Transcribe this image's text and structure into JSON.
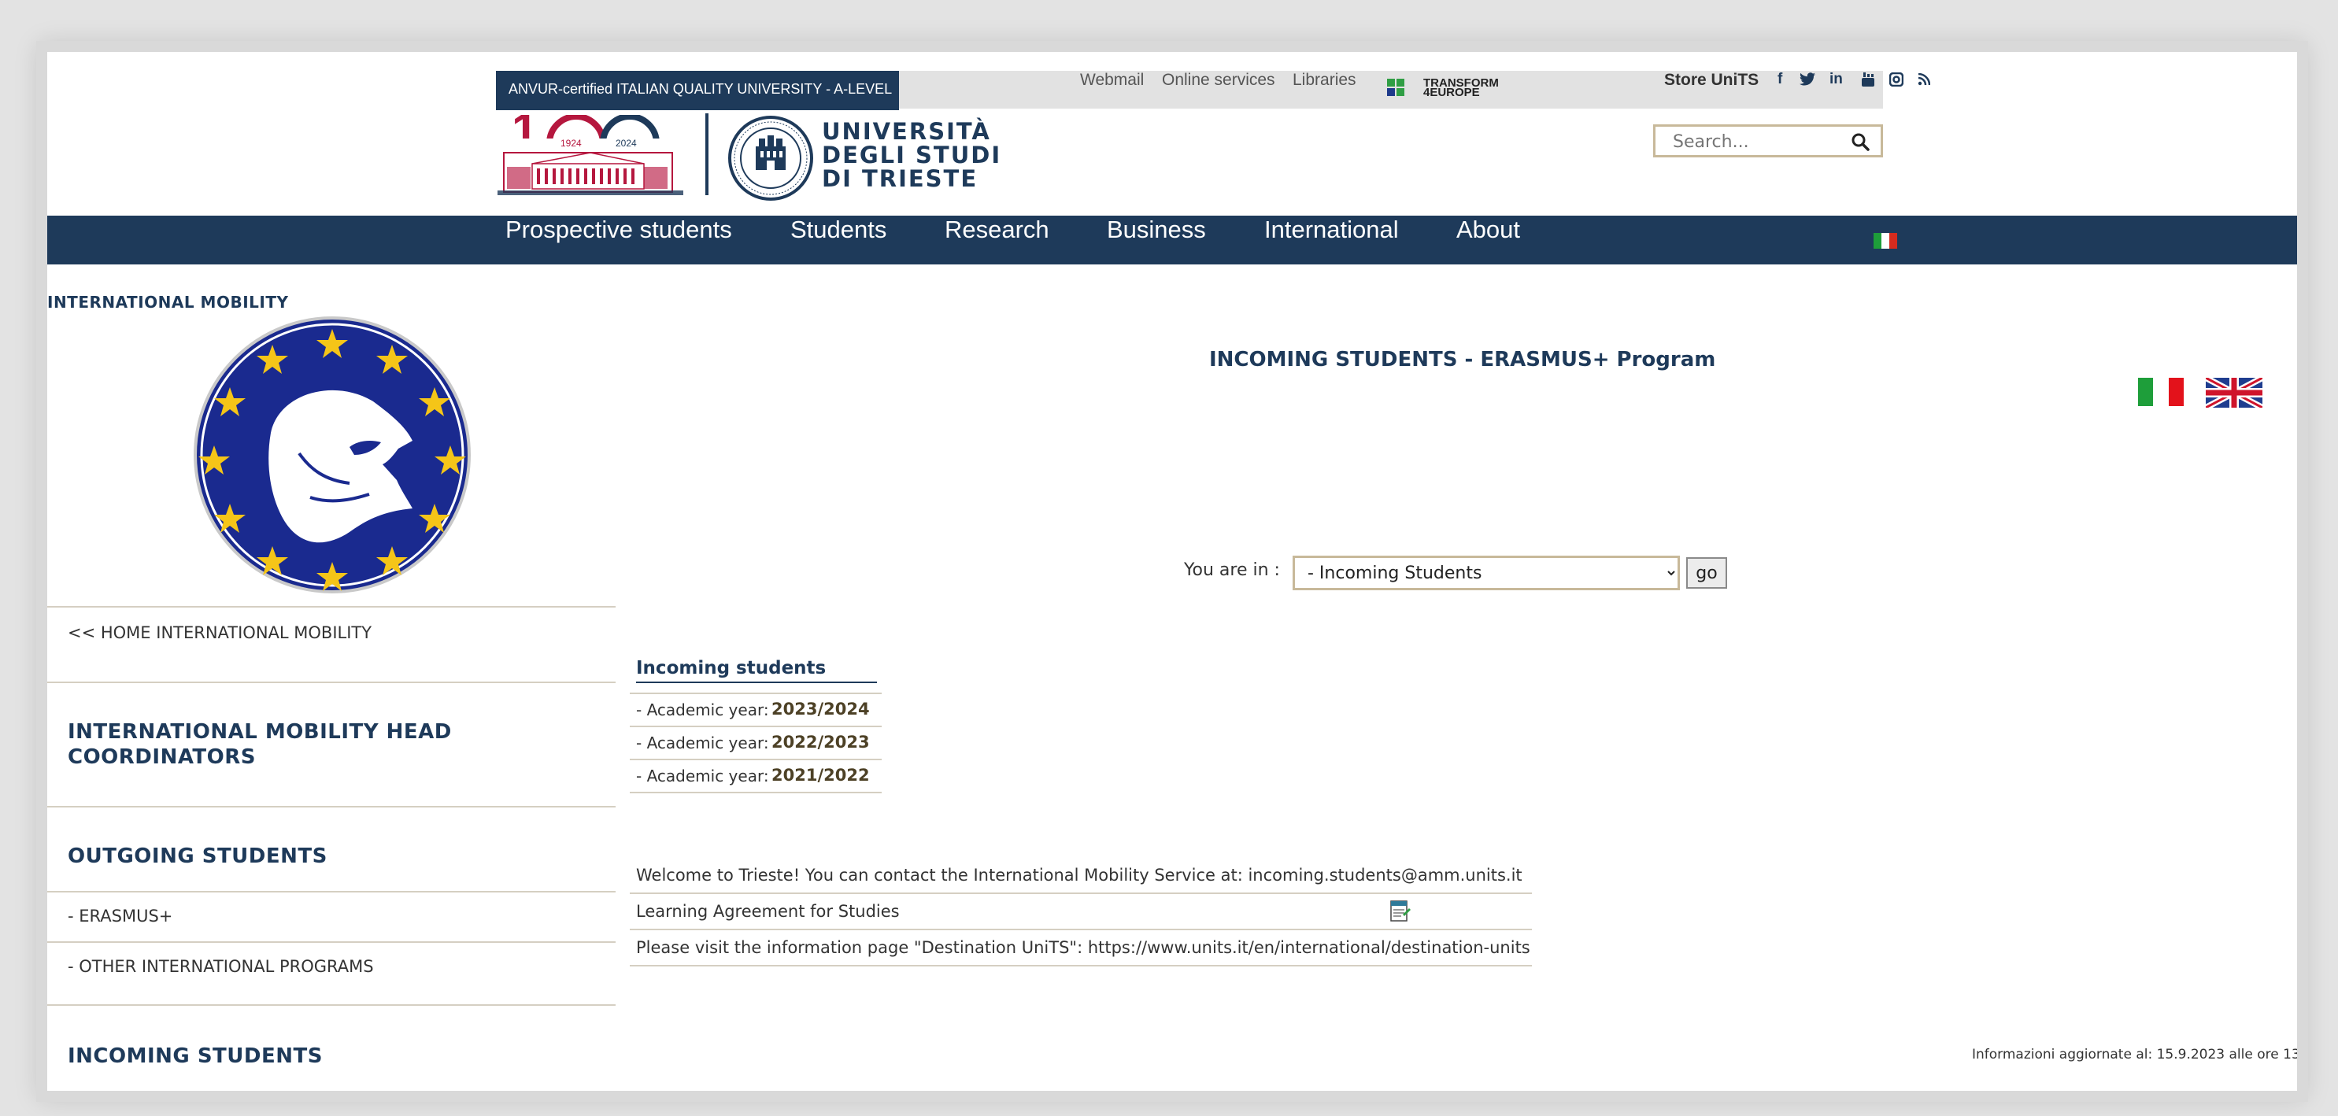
{
  "header": {
    "quality_banner": "ANVUR-certified ITALIAN QUALITY UNIVERSITY - A-LEVEL",
    "links": [
      "Webmail",
      "Online services",
      "Libraries"
    ],
    "transform_logo": "TRANSFORM 4EUROPE",
    "store": "Store UniTS",
    "social_icons": [
      "facebook-icon",
      "twitter-icon",
      "linkedin-icon",
      "youtube-icon",
      "instagram-icon",
      "rss-icon"
    ],
    "centenary": {
      "year_start": "1924",
      "year_end": "2024"
    },
    "university_name": [
      "UNIVERSITÀ",
      "DEGLI STUDI",
      "DI TRIESTE"
    ],
    "search_placeholder": "Search..."
  },
  "nav": {
    "items": [
      "Prospective students",
      "Students",
      "Research",
      "Business",
      "International",
      "About"
    ]
  },
  "sidebar": {
    "title": "INTERNATIONAL MOBILITY",
    "home_link": "<< HOME INTERNATIONAL MOBILITY",
    "head_coordinators": "INTERNATIONAL MOBILITY HEAD COORDINATORS",
    "outgoing_heading": "OUTGOING STUDENTS",
    "outgoing_items": [
      "- ERASMUS+",
      "- OTHER INTERNATIONAL PROGRAMS"
    ],
    "incoming_heading": "INCOMING STUDENTS"
  },
  "main": {
    "title": "INCOMING STUDENTS - ERASMUS+ Program",
    "you_are_in": "You are in :",
    "select_value": "- Incoming Students",
    "go_label": "go",
    "incoming_heading": "Incoming students",
    "academic_years": [
      {
        "label": "- Academic year:",
        "value": "2023/2024"
      },
      {
        "label": "- Academic year:",
        "value": "2022/2023"
      },
      {
        "label": "- Academic year:",
        "value": "2021/2022"
      }
    ],
    "info_rows": [
      "Welcome to Trieste! You can contact the International Mobility Service at: incoming.students@amm.units.it",
      "Learning Agreement for Studies",
      "Please visit the information page \"Destination UniTS\": https://www.units.it/en/international/destination-units"
    ],
    "updated": "Informazioni aggiornate al: 15.9.2023 alle ore 13"
  },
  "colors": {
    "navy": "#1e3a5a",
    "gold": "#c8b99a",
    "erasmus_blue": "#1a2a8f",
    "star_yellow": "#f5c518"
  }
}
